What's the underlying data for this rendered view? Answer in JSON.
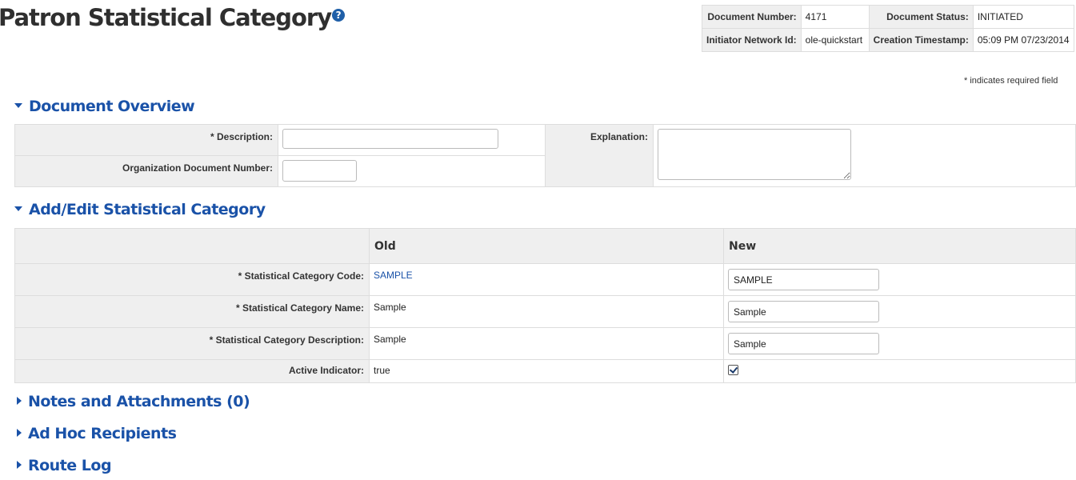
{
  "page": {
    "title": "Patron Statistical Category",
    "help": "?"
  },
  "doc_header": {
    "document_number_label": "Document Number:",
    "document_number": "4171",
    "document_status_label": "Document Status:",
    "document_status": "INITIATED",
    "initiator_label": "Initiator Network Id:",
    "initiator": "ole-quickstart",
    "creation_label": "Creation Timestamp:",
    "creation": "05:09 PM 07/23/2014"
  },
  "required_note": "* indicates required field",
  "document_overview": {
    "title": "Document Overview",
    "description_label": "* Description:",
    "description_value": "",
    "org_doc_number_label": "Organization Document Number:",
    "org_doc_number_value": "",
    "explanation_label": "Explanation:",
    "explanation_value": ""
  },
  "add_edit": {
    "title": "Add/Edit Statistical Category",
    "col_old": "Old",
    "col_new": "New",
    "rows": [
      {
        "label": "* Statistical Category Code:",
        "old": "SAMPLE",
        "new": "SAMPLE"
      },
      {
        "label": "* Statistical Category Name:",
        "old": "Sample",
        "new": "Sample"
      },
      {
        "label": "* Statistical Category Description:",
        "old": "Sample",
        "new": "Sample"
      },
      {
        "label": "Active Indicator:",
        "old": "true",
        "new": true
      }
    ]
  },
  "collapsed_sections": [
    "Notes and Attachments (0)",
    "Ad Hoc Recipients",
    "Route Log"
  ]
}
